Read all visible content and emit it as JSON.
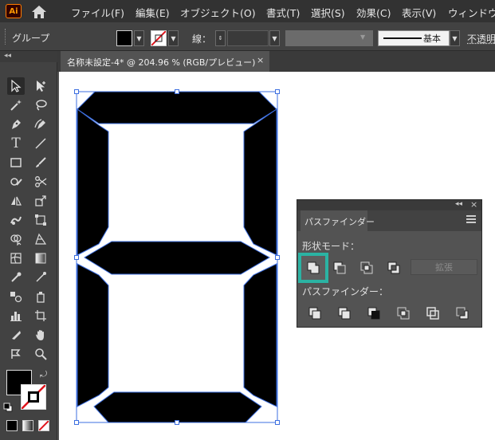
{
  "app": {
    "logo_text": "Ai"
  },
  "menu": {
    "items": [
      "ファイル(F)",
      "編集(E)",
      "オブジェクト(O)",
      "書式(T)",
      "選択(S)",
      "効果(C)",
      "表示(V)",
      "ウィンドウ"
    ]
  },
  "control_bar": {
    "selection_type": "グループ",
    "stroke_label": "線：",
    "brush_label": "基本",
    "opacity_label": "不透明"
  },
  "toolbox": {
    "collapse_glyph": "◂◂"
  },
  "document": {
    "tab_label": "名称未設定-4* @ 204.96 % (RGB/プレビュー)",
    "close_glyph": "×"
  },
  "pathfinder": {
    "collapse_glyph": "◂◂",
    "close_glyph": "×",
    "tab_label": "パスファインダー",
    "shape_modes_label": "形状モード：",
    "pathfinders_label": "パスファインダー：",
    "expand_label": "拡張"
  },
  "colors": {
    "accent_highlight": "#2bb3a3",
    "segment_fill": "#000000",
    "selection_blue": "#3d6fe0"
  }
}
